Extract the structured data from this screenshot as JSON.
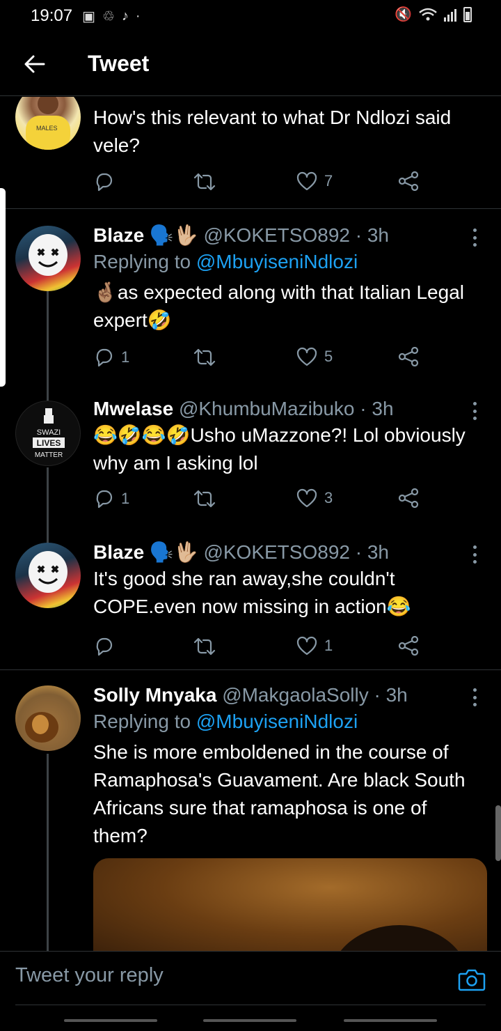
{
  "status_bar": {
    "time": "19:07"
  },
  "header": {
    "title": "Tweet"
  },
  "tweets": [
    {
      "name": "",
      "handle_time": "",
      "text": "How's this relevant to what Dr Ndlozi said vele?",
      "reply": "",
      "retweet": "",
      "like": "7"
    },
    {
      "name": "Blaze",
      "handle_time": "@KOKETSO892 · 3h",
      "reply_prefix": "Replying to",
      "reply_handle": "@MbuyiseniNdlozi",
      "text": "🤞🏽as expected along with that Italian Legal expert🤣",
      "reply": "1",
      "retweet": "",
      "like": "5"
    },
    {
      "name": "Mwelase",
      "handle_time": "@KhumbuMazibuko · 3h",
      "text": "😂🤣😂🤣Usho uMazzone?! Lol obviously why am I asking lol",
      "reply": "1",
      "retweet": "",
      "like": "3",
      "avatar_text": [
        "SWAZI",
        "LIVES",
        "MATTER"
      ]
    },
    {
      "name": "Blaze",
      "handle_time": "@KOKETSO892 · 3h",
      "text": "It's good she ran away,she couldn't COPE.even now missing in action😂",
      "reply": "",
      "retweet": "",
      "like": "1"
    },
    {
      "name": "Solly Mnyaka",
      "handle_time": "@MakgaolaSolly · 3h",
      "reply_prefix": "Replying to",
      "reply_handle": "@MbuyiseniNdlozi",
      "text": "She is more emboldened in the course of Ramaphosa's Guavament. Are black South Africans sure that ramaphosa is one of them?",
      "reply": "",
      "retweet": "",
      "like": ""
    }
  ],
  "reply_bar": {
    "placeholder": "Tweet your reply"
  },
  "colors": {
    "background": "#000000",
    "secondary_text": "#8899a6",
    "link": "#1da1f2",
    "divider": "#2f3336"
  },
  "icons": [
    "back-arrow-icon",
    "reply-icon",
    "retweet-icon",
    "like-icon",
    "share-icon",
    "more-icon",
    "camera-icon"
  ]
}
